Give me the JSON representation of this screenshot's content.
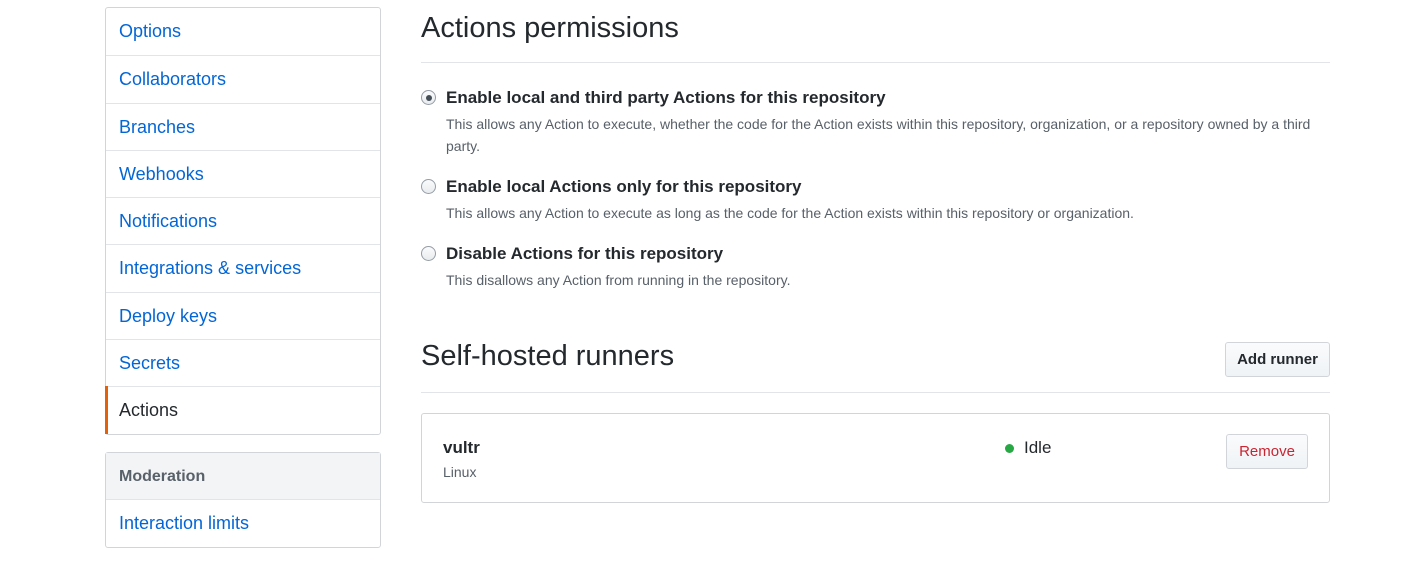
{
  "sidebar": {
    "items": [
      {
        "label": "Options"
      },
      {
        "label": "Collaborators"
      },
      {
        "label": "Branches"
      },
      {
        "label": "Webhooks"
      },
      {
        "label": "Notifications"
      },
      {
        "label": "Integrations & services"
      },
      {
        "label": "Deploy keys"
      },
      {
        "label": "Secrets"
      },
      {
        "label": "Actions",
        "selected": true
      }
    ],
    "moderation": {
      "heading": "Moderation",
      "items": [
        {
          "label": "Interaction limits"
        }
      ]
    },
    "selected_accent": "#e36209"
  },
  "actions_permissions": {
    "title": "Actions permissions",
    "options": [
      {
        "title": "Enable local and third party Actions for this repository",
        "note": "This allows any Action to execute, whether the code for the Action exists within this repository, organization, or a repository owned by a third party.",
        "checked": true
      },
      {
        "title": "Enable local Actions only for this repository",
        "note": "This allows any Action to execute as long as the code for the Action exists within this repository or organization.",
        "checked": false
      },
      {
        "title": "Disable Actions for this repository",
        "note": "This disallows any Action from running in the repository.",
        "checked": false
      }
    ]
  },
  "self_hosted_runners": {
    "title": "Self-hosted runners",
    "add_button": "Add runner",
    "runners": [
      {
        "name": "vultr",
        "os": "Linux",
        "status": "Idle",
        "status_color": "#28a745",
        "remove_button": "Remove"
      }
    ]
  },
  "colors": {
    "link": "#0366d6",
    "danger": "#cb2431"
  }
}
